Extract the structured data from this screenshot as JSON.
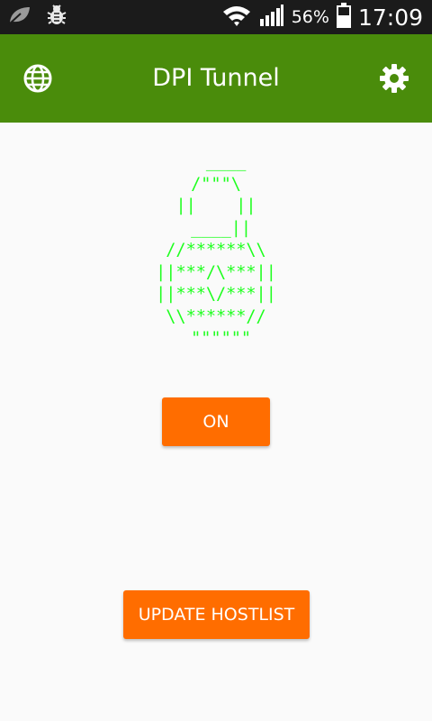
{
  "status_bar": {
    "battery_percent": "56%",
    "time": "17:09",
    "icons": [
      "leaf-icon",
      "bug-icon",
      "wifi-icon",
      "signal-icon",
      "battery-icon"
    ]
  },
  "toolbar": {
    "title": "DPI Tunnel",
    "left_icon": "globe-icon",
    "right_icon": "gear-icon",
    "color": "#4a8c0b"
  },
  "main": {
    "lock_ascii": "  ____\n /\"\"\"\\ \n||    ||\n ____||\n//******\\\\\n||***/\\***||\n||***\\/***||\n\\\\******//\n \"\"\"\"\"\"",
    "ascii_color": "#1eff1e",
    "toggle_label": "ON",
    "update_label": "UPDATE HOSTLIST",
    "button_color": "#ff6d00"
  }
}
